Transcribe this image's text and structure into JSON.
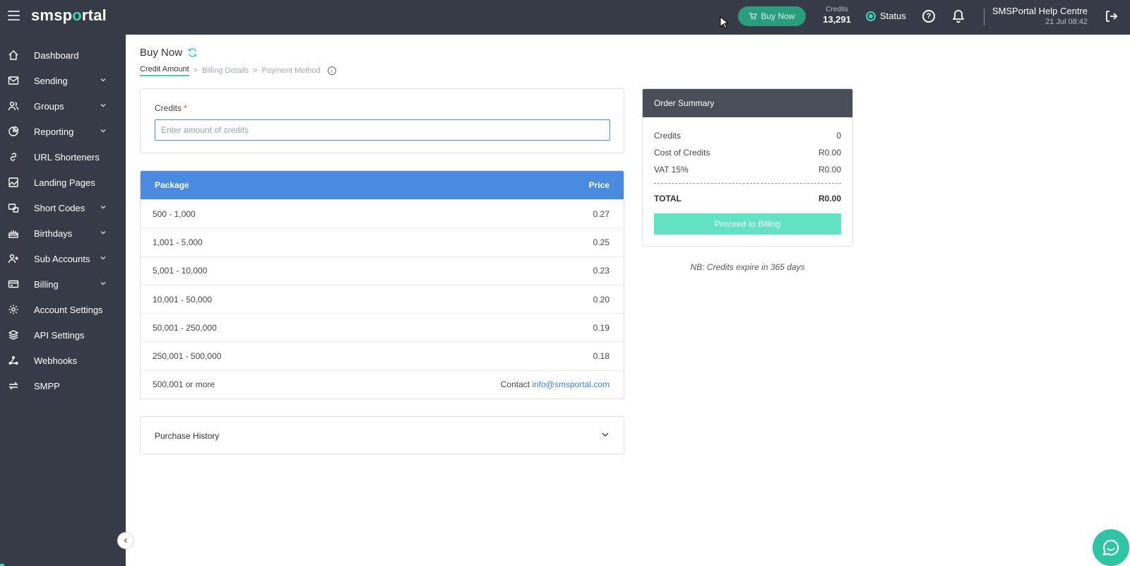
{
  "header": {
    "logo_prefix": "smsp",
    "logo_o": "o",
    "logo_suffix": "rtal",
    "buy_now_label": "Buy Now",
    "credits_label": "Credits",
    "credits_value": "13,291",
    "status_label": "Status",
    "user_name": "SMSPortal Help Centre",
    "user_date": "21 Jul 08:42"
  },
  "sidebar": {
    "items": [
      {
        "label": "Dashboard",
        "icon": "home-icon",
        "expandable": false
      },
      {
        "label": "Sending",
        "icon": "mail-icon",
        "expandable": true
      },
      {
        "label": "Groups",
        "icon": "users-icon",
        "expandable": true
      },
      {
        "label": "Reporting",
        "icon": "pie-chart-icon",
        "expandable": true
      },
      {
        "label": "URL Shorteners",
        "icon": "link-icon",
        "expandable": false
      },
      {
        "label": "Landing Pages",
        "icon": "landing-page-icon",
        "expandable": false
      },
      {
        "label": "Short Codes",
        "icon": "short-code-icon",
        "expandable": true
      },
      {
        "label": "Birthdays",
        "icon": "cake-icon",
        "expandable": true
      },
      {
        "label": "Sub Accounts",
        "icon": "user-plus-icon",
        "expandable": true
      },
      {
        "label": "Billing",
        "icon": "credit-card-icon",
        "expandable": true
      },
      {
        "label": "Account Settings",
        "icon": "gear-icon",
        "expandable": false
      },
      {
        "label": "API Settings",
        "icon": "layers-icon",
        "expandable": false
      },
      {
        "label": "Webhooks",
        "icon": "webhook-icon",
        "expandable": false
      },
      {
        "label": "SMPP",
        "icon": "swap-icon",
        "expandable": false
      }
    ]
  },
  "page": {
    "title": "Buy Now",
    "breadcrumb": {
      "step1": "Credit Amount",
      "sep1": ">",
      "step2": "Billing Details",
      "sep2": ">",
      "step3": "Payment Method"
    },
    "credits_label": "Credits",
    "credits_required": "*",
    "credits_placeholder": "Enter amount of credits",
    "credits_value": ""
  },
  "packages": {
    "col_package": "Package",
    "col_price": "Price",
    "rows": [
      {
        "range": "500 - 1,000",
        "price": "0.27"
      },
      {
        "range": "1,001 - 5,000",
        "price": "0.25"
      },
      {
        "range": "5,001 - 10,000",
        "price": "0.23"
      },
      {
        "range": "10,001 - 50,000",
        "price": "0.20"
      },
      {
        "range": "50,001 - 250,000",
        "price": "0.19"
      },
      {
        "range": "250,001 - 500,000",
        "price": "0.18"
      }
    ],
    "last_row": {
      "range": "500,001 or more",
      "contact_prefix": "Contact ",
      "contact_email": "info@smsportal.com"
    }
  },
  "purchase_history": {
    "title": "Purchase History"
  },
  "order_summary": {
    "title": "Order Summary",
    "credits_label": "Credits",
    "credits_value": "0",
    "cost_label": "Cost of Credits",
    "cost_value": "R0.00",
    "vat_label": "VAT 15%",
    "vat_value": "R0.00",
    "total_label": "TOTAL",
    "total_value": "R0.00",
    "proceed_label": "Proceed to Billing",
    "note": "NB: Credits expire in 365 days"
  },
  "colors": {
    "topbar": "#373b48",
    "accent_teal": "#3fd3b4",
    "table_header": "#4a8be0",
    "proceed_button": "#63e3c3",
    "order_header": "#4a4e59"
  }
}
